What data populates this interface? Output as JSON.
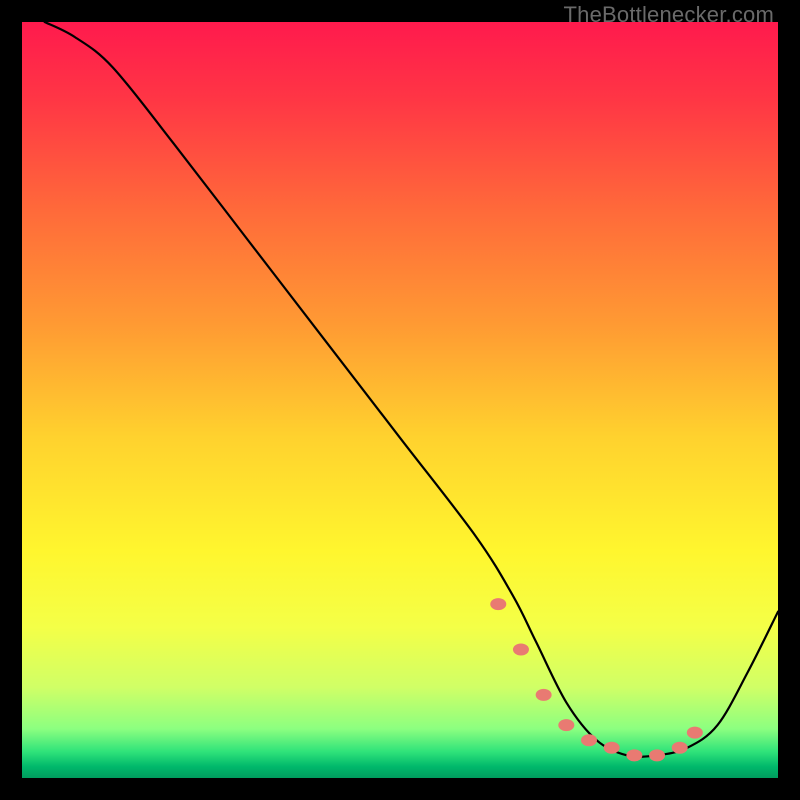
{
  "watermark": "TheBottlenecker.com",
  "gradient": {
    "stops": [
      {
        "offset": 0.0,
        "color": "#ff1a4d"
      },
      {
        "offset": 0.1,
        "color": "#ff3545"
      },
      {
        "offset": 0.25,
        "color": "#ff6a3a"
      },
      {
        "offset": 0.4,
        "color": "#ff9a33"
      },
      {
        "offset": 0.55,
        "color": "#ffd22e"
      },
      {
        "offset": 0.7,
        "color": "#fff62e"
      },
      {
        "offset": 0.8,
        "color": "#f4ff47"
      },
      {
        "offset": 0.88,
        "color": "#d0ff66"
      },
      {
        "offset": 0.935,
        "color": "#8cff80"
      },
      {
        "offset": 0.965,
        "color": "#30e37a"
      },
      {
        "offset": 0.985,
        "color": "#00b86b"
      },
      {
        "offset": 1.0,
        "color": "#009c5e"
      }
    ]
  },
  "chart_data": {
    "type": "line",
    "title": "",
    "xlabel": "",
    "ylabel": "",
    "xlim": [
      0,
      100
    ],
    "ylim": [
      0,
      100
    ],
    "series": [
      {
        "name": "bottleneck-curve",
        "x": [
          3,
          7,
          12,
          20,
          30,
          40,
          50,
          60,
          65,
          68,
          72,
          76,
          80,
          84,
          88,
          92,
          96,
          100
        ],
        "values": [
          100,
          98,
          94,
          84,
          71,
          58,
          45,
          32,
          24,
          18,
          10,
          5,
          3,
          3,
          4,
          7,
          14,
          22
        ]
      }
    ],
    "markers": {
      "name": "highlight-dots",
      "color": "#e97a72",
      "x": [
        63,
        66,
        69,
        72,
        75,
        78,
        81,
        84,
        87,
        89
      ],
      "values": [
        23,
        17,
        11,
        7,
        5,
        4,
        3,
        3,
        4,
        6
      ]
    }
  }
}
